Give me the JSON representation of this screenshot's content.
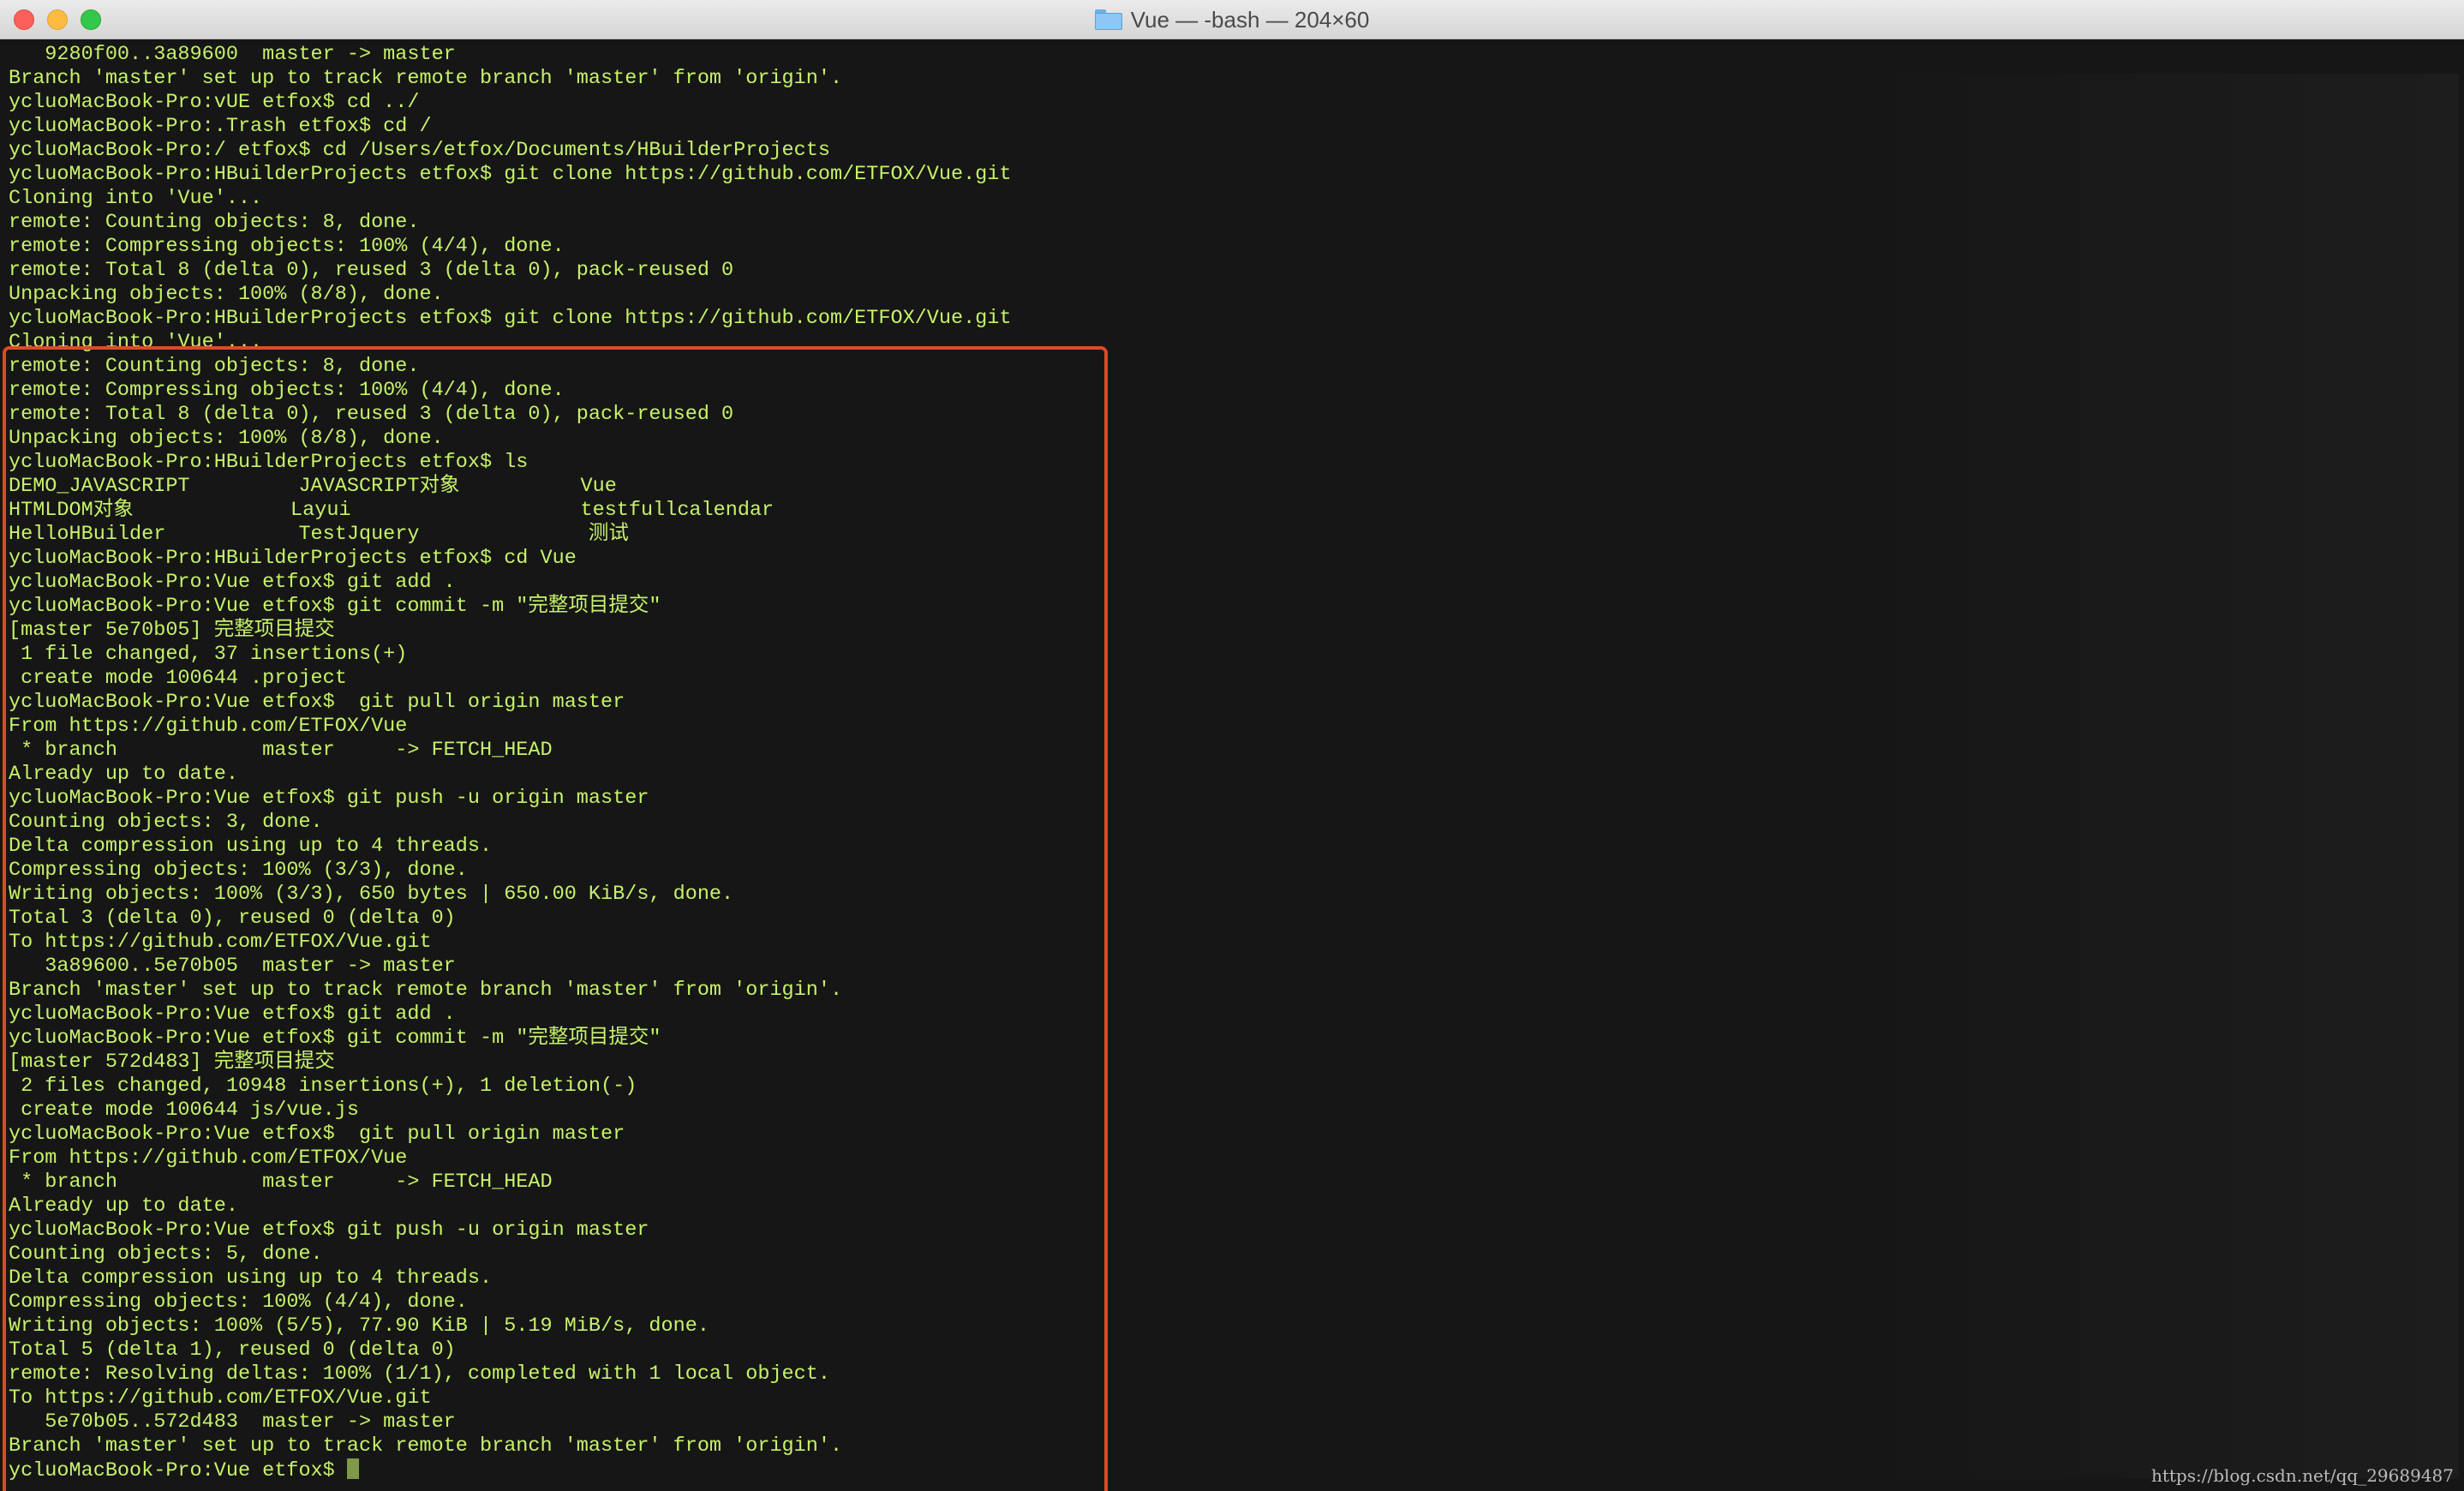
{
  "window": {
    "title": "Vue — -bash — 204×60",
    "folder_icon": "folder-icon"
  },
  "terminal": {
    "lines": [
      "   9280f00..3a89600  master -> master",
      "Branch 'master' set up to track remote branch 'master' from 'origin'.",
      "ycluoMacBook-Pro:vUE etfox$ cd ../",
      "ycluoMacBook-Pro:.Trash etfox$ cd /",
      "ycluoMacBook-Pro:/ etfox$ cd /Users/etfox/Documents/HBuilderProjects",
      "ycluoMacBook-Pro:HBuilderProjects etfox$ git clone https://github.com/ETFOX/Vue.git",
      "Cloning into 'Vue'...",
      "remote: Counting objects: 8, done.",
      "remote: Compressing objects: 100% (4/4), done.",
      "remote: Total 8 (delta 0), reused 3 (delta 0), pack-reused 0",
      "Unpacking objects: 100% (8/8), done.",
      "ycluoMacBook-Pro:HBuilderProjects etfox$ git clone https://github.com/ETFOX/Vue.git",
      "Cloning into 'Vue'...",
      "remote: Counting objects: 8, done.",
      "remote: Compressing objects: 100% (4/4), done.",
      "remote: Total 8 (delta 0), reused 3 (delta 0), pack-reused 0",
      "Unpacking objects: 100% (8/8), done.",
      "ycluoMacBook-Pro:HBuilderProjects etfox$ ls",
      "DEMO_JAVASCRIPT         JAVASCRIPT对象          Vue",
      "HTMLDOM对象             Layui                   testfullcalendar",
      "HelloHBuilder           TestJquery              测试",
      "ycluoMacBook-Pro:HBuilderProjects etfox$ cd Vue",
      "ycluoMacBook-Pro:Vue etfox$ git add .",
      "ycluoMacBook-Pro:Vue etfox$ git commit -m \"完整项目提交\"",
      "[master 5e70b05] 完整项目提交",
      " 1 file changed, 37 insertions(+)",
      " create mode 100644 .project",
      "ycluoMacBook-Pro:Vue etfox$  git pull origin master",
      "From https://github.com/ETFOX/Vue",
      " * branch            master     -> FETCH_HEAD",
      "Already up to date.",
      "ycluoMacBook-Pro:Vue etfox$ git push -u origin master",
      "Counting objects: 3, done.",
      "Delta compression using up to 4 threads.",
      "Compressing objects: 100% (3/3), done.",
      "Writing objects: 100% (3/3), 650 bytes | 650.00 KiB/s, done.",
      "Total 3 (delta 0), reused 0 (delta 0)",
      "To https://github.com/ETFOX/Vue.git",
      "   3a89600..5e70b05  master -> master",
      "Branch 'master' set up to track remote branch 'master' from 'origin'.",
      "ycluoMacBook-Pro:Vue etfox$ git add .",
      "ycluoMacBook-Pro:Vue etfox$ git commit -m \"完整项目提交\"",
      "[master 572d483] 完整项目提交",
      " 2 files changed, 10948 insertions(+), 1 deletion(-)",
      " create mode 100644 js/vue.js",
      "ycluoMacBook-Pro:Vue etfox$  git pull origin master",
      "From https://github.com/ETFOX/Vue",
      " * branch            master     -> FETCH_HEAD",
      "Already up to date.",
      "ycluoMacBook-Pro:Vue etfox$ git push -u origin master",
      "Counting objects: 5, done.",
      "Delta compression using up to 4 threads.",
      "Compressing objects: 100% (4/4), done.",
      "Writing objects: 100% (5/5), 77.90 KiB | 5.19 MiB/s, done.",
      "Total 5 (delta 1), reused 0 (delta 0)",
      "remote: Resolving deltas: 100% (1/1), completed with 1 local object.",
      "To https://github.com/ETFOX/Vue.git",
      "   5e70b05..572d483  master -> master",
      "Branch 'master' set up to track remote branch 'master' from 'origin'.",
      "ycluoMacBook-Pro:Vue etfox$ "
    ],
    "text_color": "#c7f26a",
    "background_color": "#161616"
  },
  "annotation": {
    "highlight_color": "#e0482a"
  },
  "watermark": "https://blog.csdn.net/qq_29689487"
}
